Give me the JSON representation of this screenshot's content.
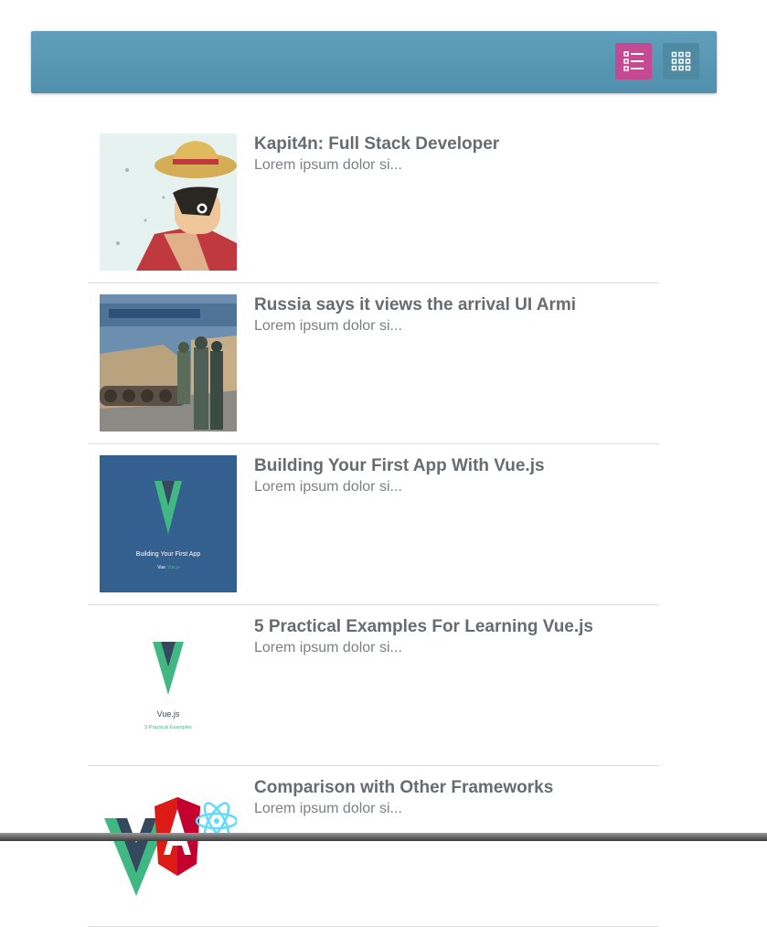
{
  "toolbar": {
    "list_view_icon": "list-view-icon",
    "grid_view_icon": "grid-view-icon",
    "accent_active": "#c64a93",
    "bar_color": "#5a98b3"
  },
  "articles": [
    {
      "title": "Kapit4n: Full Stack Developer",
      "excerpt": "Lorem ipsum dolor si...",
      "thumb": "anime-character-straw-hat"
    },
    {
      "title": "Russia says it views the arrival UI Armi",
      "excerpt": "Lorem ipsum dolor si...",
      "thumb": "tanks-and-soldiers-photo"
    },
    {
      "title": "Building Your First App With Vue.js",
      "excerpt": "Lorem ipsum dolor si...",
      "thumb": "vue-logo-blue-card",
      "thumb_caption": "Building Your First App",
      "thumb_sub_a": "Vue",
      "thumb_sub_b": "Vue.js"
    },
    {
      "title": "5 Practical Examples For Learning Vue.js",
      "excerpt": "Lorem ipsum dolor si...",
      "thumb": "vue-logo-white-card",
      "thumb_caption": "Vue.js",
      "thumb_sub": "5 Practical Examples"
    },
    {
      "title": "Comparison with Other Frameworks",
      "excerpt": "Lorem ipsum dolor si...",
      "thumb": "framework-logos"
    }
  ]
}
